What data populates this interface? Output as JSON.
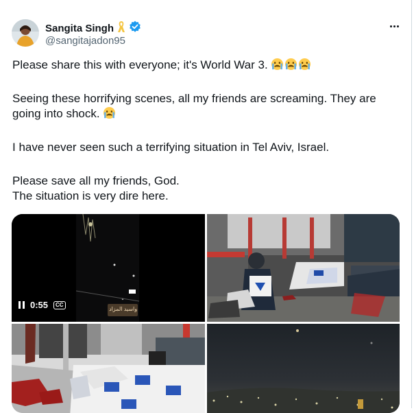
{
  "post": {
    "author_name": "Sangita Singh",
    "author_handle": "@sangitajadon95",
    "more_icon": "more-horizontal-icon",
    "ribbon_icon": "yellow-ribbon-icon",
    "verified_icon": "verified-badge-icon",
    "lines": [
      "Please share this with everyone; it's World War 3.",
      "Seeing these horrifying scenes, all my friends are screaming. They are",
      "going into shock.",
      "I have never seen such a terrifying situation in Tel Aviv, Israel.",
      "Please save all my friends, God.",
      "The situation is very dire here."
    ]
  },
  "media": {
    "video_time": "0:55",
    "cc_label": "CC",
    "sign_text": "واسيد المزاد"
  },
  "colors": {
    "verified": "#1d9bf0",
    "ribbon": "#f4c542",
    "handle": "#536471",
    "text": "#0f1419"
  }
}
